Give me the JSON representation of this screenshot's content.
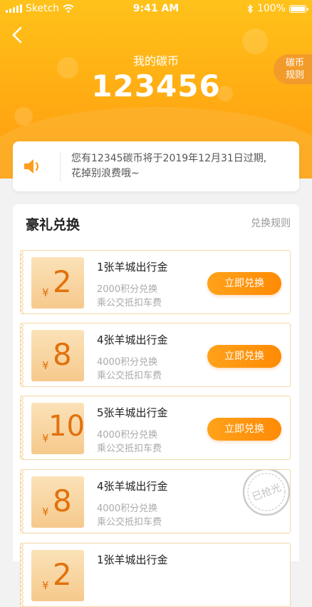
{
  "status_bar": {
    "carrier": "Sketch",
    "time": "9:41 AM",
    "battery": "100%"
  },
  "header": {
    "title": "我的碳币",
    "amount": "123456",
    "rules_line1": "碳币",
    "rules_line2": "规则"
  },
  "notice": {
    "line1": "您有12345碳币将于2019年12月31日过期,",
    "line2": "花掉别浪费哦~"
  },
  "exchange": {
    "title": "豪礼兑换",
    "rules_link": "兑换规则",
    "currency_symbol": "¥",
    "stamp_text": "已抢光",
    "items": [
      {
        "value": "2",
        "name": "1张羊城出行金",
        "points": "2000积分兑换",
        "desc": "乘公交抵扣车费",
        "button": "立即兑换"
      },
      {
        "value": "8",
        "name": "4张羊城出行金",
        "points": "4000积分兑换",
        "desc": "乘公交抵扣车费",
        "button": "立即兑换"
      },
      {
        "value": "10",
        "name": "5张羊城出行金",
        "points": "4000积分兑换",
        "desc": "乘公交抵扣车费",
        "button": "立即兑换"
      },
      {
        "value": "8",
        "name": "4张羊城出行金",
        "points": "4000积分兑换",
        "desc": "乘公交抵扣车费",
        "status": "已抢光"
      },
      {
        "value": "2",
        "name": "1张羊城出行金"
      }
    ]
  },
  "colors": {
    "brand_orange": "#ff9a10",
    "coupon_text": "#e1710d"
  }
}
